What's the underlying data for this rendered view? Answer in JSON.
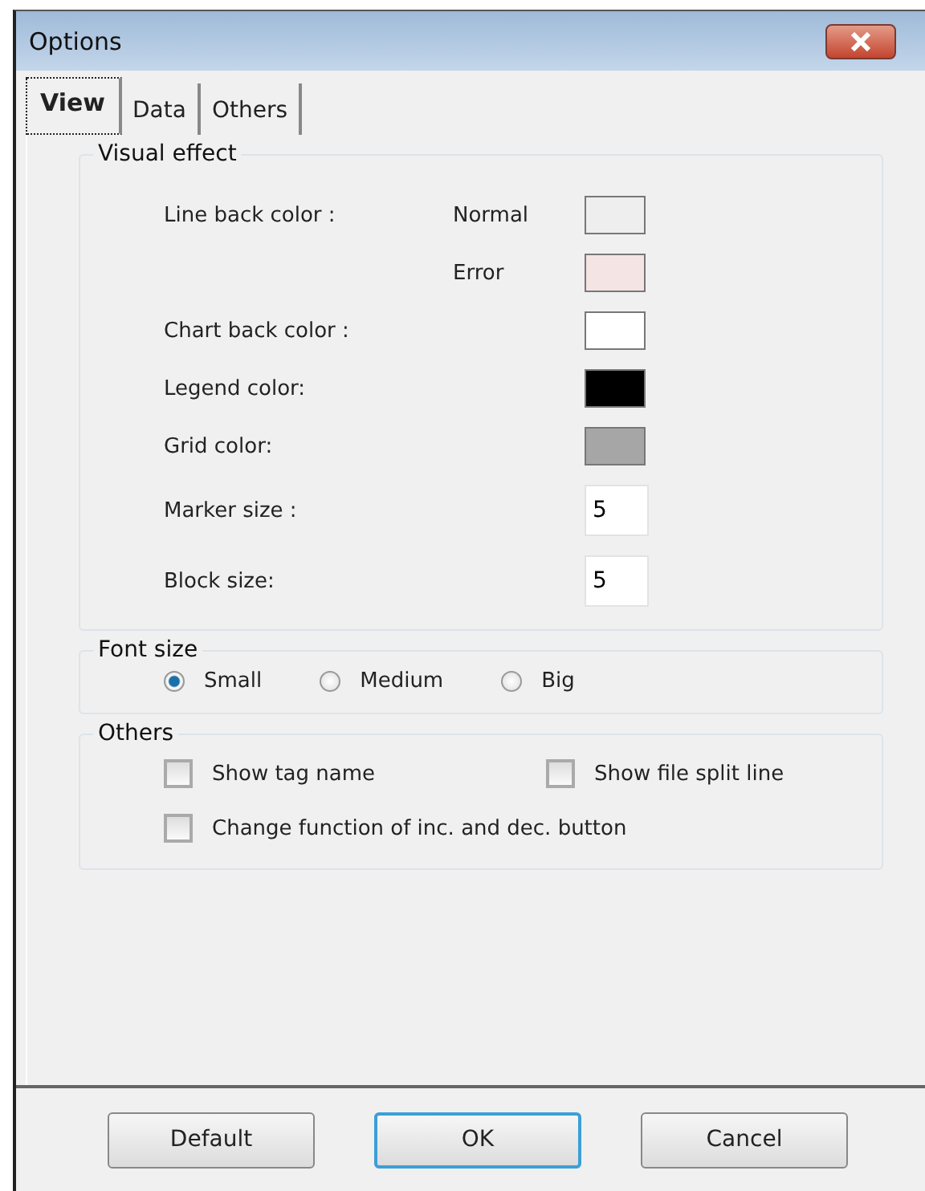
{
  "window": {
    "title": "Options"
  },
  "tabs": [
    {
      "label": "View",
      "selected": true
    },
    {
      "label": "Data",
      "selected": false
    },
    {
      "label": "Others",
      "selected": false
    }
  ],
  "visual_effect": {
    "title": "Visual effect",
    "rows": [
      {
        "kind": "swatch",
        "label": "Line back color :",
        "sublabel": "Normal",
        "color": "#eeeeee"
      },
      {
        "kind": "swatch",
        "sublabel": "Error",
        "color": "#f5e4e4"
      },
      {
        "kind": "swatch",
        "label": "Chart back color :",
        "color": "#ffffff"
      },
      {
        "kind": "swatch",
        "label": "Legend color:",
        "color": "#000000"
      },
      {
        "kind": "swatch",
        "label": "Grid color:",
        "color": "#a6a6a6"
      },
      {
        "kind": "number",
        "label": "Marker size :",
        "value": "5"
      },
      {
        "kind": "number",
        "label": "Block size:",
        "value": "5"
      }
    ]
  },
  "font_size": {
    "title": "Font size",
    "options": [
      {
        "label": "Small",
        "selected": true
      },
      {
        "label": "Medium",
        "selected": false
      },
      {
        "label": "Big",
        "selected": false
      }
    ]
  },
  "others": {
    "title": "Others",
    "options": [
      {
        "label": "Show tag name",
        "checked": false
      },
      {
        "label": "Show file split line",
        "checked": false
      },
      {
        "label": "Change function of inc.  and dec. button",
        "checked": false
      }
    ]
  },
  "buttons": [
    {
      "label": "Default",
      "focused": false
    },
    {
      "label": "OK",
      "focused": true
    },
    {
      "label": "Cancel",
      "focused": false
    }
  ]
}
